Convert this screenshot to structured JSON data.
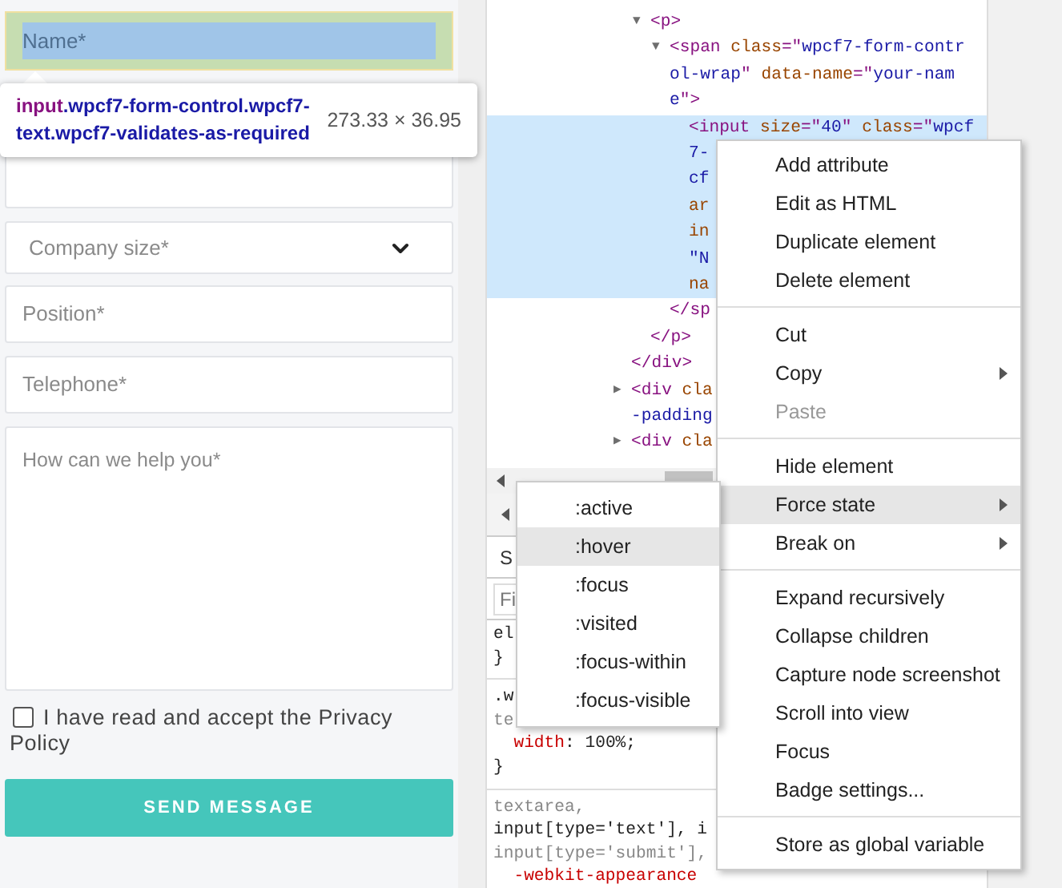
{
  "form": {
    "fields": [
      {
        "kind": "input",
        "placeholder": "Name*",
        "inspected": true
      },
      {
        "kind": "input",
        "inspected": false
      },
      {
        "kind": "select",
        "placeholder": "Company size*",
        "inspected": false
      },
      {
        "kind": "input",
        "placeholder": "Position*",
        "inspected": false
      },
      {
        "kind": "input",
        "placeholder": "Telephone*",
        "inspected": false
      },
      {
        "kind": "textarea",
        "placeholder": "How can we help you*",
        "inspected": false
      }
    ],
    "consent": {
      "label": "I have read and accept the Privacy Policy",
      "checked": false
    },
    "submit": "SEND MESSAGE"
  },
  "tooltip": {
    "tag": "input",
    "classes": ".wpcf7-form-control.wpcf7-text.wpcf7-validates-as-required",
    "size": "273.33 × 36.95"
  },
  "dom_tree": [
    {
      "children": [
        {
          "toggle": "▼",
          "lines": [
            [
              {
                "kind": "tag",
                "text": "<p>"
              }
            ]
          ],
          "children": [
            {
              "toggle": "▼",
              "lines": [
                [
                  {
                    "kind": "tag",
                    "text": "<span "
                  },
                  {
                    "kind": "attr",
                    "text": "class"
                  },
                  {
                    "kind": "tag",
                    "text": "=\""
                  },
                  {
                    "kind": "value",
                    "text": "wpcf7-form-contr"
                  }
                ],
                [
                  {
                    "kind": "value",
                    "text": "ol-wrap"
                  },
                  {
                    "kind": "tag",
                    "text": "\" "
                  },
                  {
                    "kind": "attr",
                    "text": "data-name"
                  },
                  {
                    "kind": "tag",
                    "text": "=\""
                  },
                  {
                    "kind": "value",
                    "text": "your-nam"
                  }
                ],
                [
                  {
                    "kind": "value",
                    "text": "e"
                  },
                  {
                    "kind": "tag",
                    "text": "\">"
                  }
                ]
              ],
              "children": [
                {
                  "selected": true,
                  "lines": [
                    [
                      {
                        "kind": "tag",
                        "text": "<input "
                      },
                      {
                        "kind": "attr",
                        "text": "size"
                      },
                      {
                        "kind": "tag",
                        "text": "=\""
                      },
                      {
                        "kind": "value",
                        "text": "40"
                      },
                      {
                        "kind": "tag",
                        "text": "\" "
                      },
                      {
                        "kind": "attr",
                        "text": "class"
                      },
                      {
                        "kind": "tag",
                        "text": "=\""
                      },
                      {
                        "kind": "value",
                        "text": "wpcf"
                      }
                    ],
                    [
                      {
                        "kind": "value",
                        "text": "7-"
                      }
                    ],
                    [
                      {
                        "kind": "value",
                        "text": "cf"
                      }
                    ],
                    [
                      {
                        "kind": "attr",
                        "text": "ar"
                      }
                    ],
                    [
                      {
                        "kind": "attr",
                        "text": "in"
                      }
                    ],
                    [
                      {
                        "kind": "value",
                        "text": "\"N"
                      }
                    ],
                    [
                      {
                        "kind": "attr",
                        "text": "na"
                      }
                    ]
                  ]
                }
              ],
              "close": "</sp"
            }
          ],
          "close": "</p>"
        }
      ],
      "close": "</div>"
    },
    {
      "toggle": "▶",
      "lines": [
        [
          {
            "kind": "tag",
            "text": "<div "
          },
          {
            "kind": "attr",
            "text": "cla"
          }
        ],
        [
          {
            "kind": "value",
            "text": "-padding"
          }
        ]
      ]
    },
    {
      "toggle": "▶",
      "lines": [
        [
          {
            "kind": "tag",
            "text": "<div "
          },
          {
            "kind": "attr",
            "text": "cla"
          }
        ]
      ]
    }
  ],
  "styles": {
    "tab": "S",
    "filter_placeholder": "Fi",
    "rules": [
      [
        [
          {
            "kind": "plain",
            "text": "el"
          }
        ],
        [
          {
            "kind": "plain",
            "text": "}"
          }
        ]
      ],
      [
        [
          {
            "kind": "plain",
            "text": ".w"
          }
        ],
        [
          {
            "kind": "dim",
            "text": "te"
          }
        ],
        [
          {
            "kind": "prop",
            "text": "  width"
          },
          {
            "kind": "plain",
            "text": ": 100%;"
          }
        ],
        [
          {
            "kind": "plain",
            "text": "}"
          }
        ]
      ],
      [
        [
          {
            "kind": "dim",
            "text": "textarea,"
          }
        ],
        [
          {
            "kind": "plain",
            "text": "input[type='text'], i"
          }
        ],
        [
          {
            "kind": "dim",
            "text": "input[type='submit'],"
          }
        ],
        [
          {
            "kind": "prop",
            "text": "  -webkit-appearance"
          }
        ]
      ]
    ]
  },
  "context_menu": {
    "groups": [
      [
        {
          "label": "Add attribute",
          "has_submenu": false,
          "disabled": false,
          "selected": false
        },
        {
          "label": "Edit as HTML",
          "has_submenu": false,
          "disabled": false,
          "selected": false
        },
        {
          "label": "Duplicate element",
          "has_submenu": false,
          "disabled": false,
          "selected": false
        },
        {
          "label": "Delete element",
          "has_submenu": false,
          "disabled": false,
          "selected": false
        }
      ],
      [
        {
          "label": "Cut",
          "has_submenu": false,
          "disabled": false,
          "selected": false
        },
        {
          "label": "Copy",
          "has_submenu": true,
          "disabled": false,
          "selected": false
        },
        {
          "label": "Paste",
          "has_submenu": false,
          "disabled": true,
          "selected": false
        }
      ],
      [
        {
          "label": "Hide element",
          "has_submenu": false,
          "disabled": false,
          "selected": false
        },
        {
          "label": "Force state",
          "has_submenu": true,
          "disabled": false,
          "selected": true
        },
        {
          "label": "Break on",
          "has_submenu": true,
          "disabled": false,
          "selected": false
        }
      ],
      [
        {
          "label": "Expand recursively",
          "has_submenu": false,
          "disabled": false,
          "selected": false
        },
        {
          "label": "Collapse children",
          "has_submenu": false,
          "disabled": false,
          "selected": false
        },
        {
          "label": "Capture node screenshot",
          "has_submenu": false,
          "disabled": false,
          "selected": false
        },
        {
          "label": "Scroll into view",
          "has_submenu": false,
          "disabled": false,
          "selected": false
        },
        {
          "label": "Focus",
          "has_submenu": false,
          "disabled": false,
          "selected": false
        },
        {
          "label": "Badge settings...",
          "has_submenu": false,
          "disabled": false,
          "selected": false
        }
      ],
      [
        {
          "label": "Store as global variable",
          "has_submenu": false,
          "disabled": false,
          "selected": false
        }
      ]
    ]
  },
  "force_state_menu": [
    {
      "label": ":active",
      "selected": false
    },
    {
      "label": ":hover",
      "selected": true
    },
    {
      "label": ":focus",
      "selected": false
    },
    {
      "label": ":visited",
      "selected": false
    },
    {
      "label": ":focus-within",
      "selected": false
    },
    {
      "label": ":focus-visible",
      "selected": false
    }
  ]
}
